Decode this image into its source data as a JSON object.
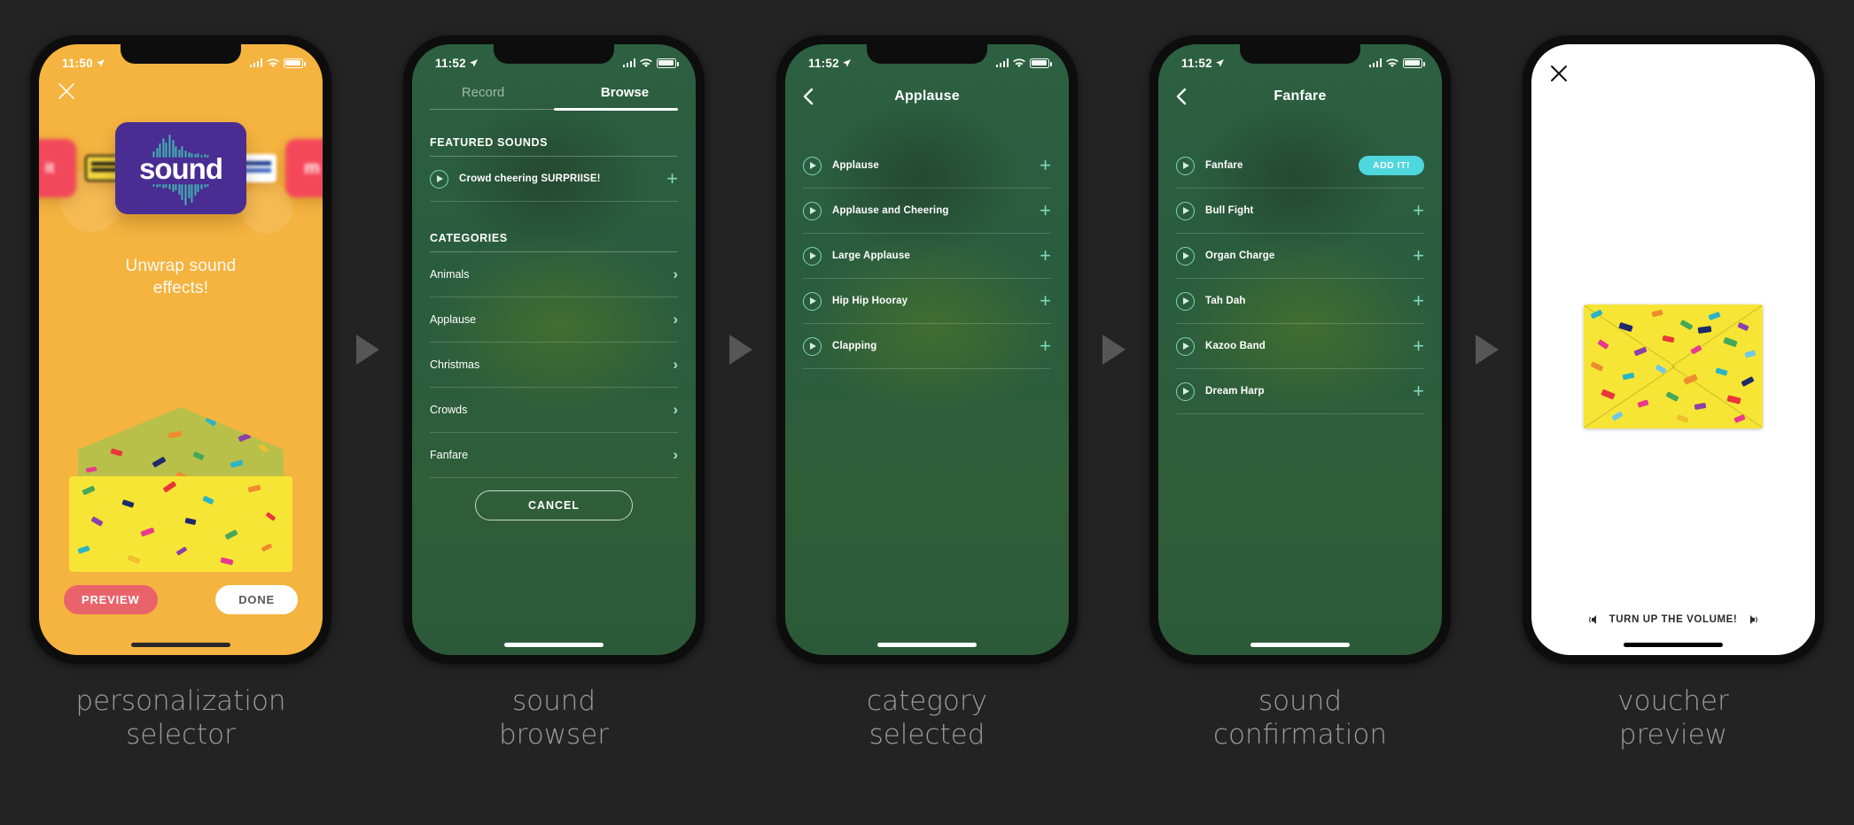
{
  "colors": {
    "board_bg": "#232323",
    "caption": "#9B9B9B",
    "arrow": "#565656",
    "amber": "#F5B33F",
    "green": "#2C6041",
    "teal_accent": "#7DD9C0",
    "cyan_button": "#4ED7DD",
    "preview_red": "#E9636B",
    "purple_tile": "#4A2D93",
    "voucher_yellow": "#F7E536"
  },
  "steps": [
    {
      "caption_line1": "personalization",
      "caption_line2": "selector",
      "screen": {
        "status": {
          "time": "11:50",
          "location_icon": "location-arrow-icon",
          "signal_icon": "cellular-bars-icon",
          "wifi_icon": "wifi-icon",
          "battery_icon": "battery-icon"
        },
        "close_icon": "close-icon",
        "tile_label": "sound",
        "title": "Unwrap sound effects!",
        "title_line1": "Unwrap sound",
        "title_line2": "effects!",
        "preview_label": "PREVIEW",
        "done_label": "DONE",
        "envelope_icon": "confetti-envelope-graphic"
      }
    },
    {
      "caption_line1": "sound",
      "caption_line2": "browser",
      "screen": {
        "status": {
          "time": "11:52",
          "location_icon": "location-arrow-icon",
          "signal_icon": "cellular-bars-icon",
          "wifi_icon": "wifi-icon",
          "battery_icon": "battery-icon"
        },
        "tabs": [
          {
            "label": "Record",
            "active": false
          },
          {
            "label": "Browse",
            "active": true
          }
        ],
        "featured_label": "FEATURED SOUNDS",
        "featured_items": [
          {
            "name": "Crowd cheering SURPRIISE!",
            "play_icon": "play-circle-icon",
            "add_icon": "plus-icon"
          }
        ],
        "categories_label": "CATEGORIES",
        "categories": [
          {
            "name": "Animals",
            "chevron_icon": "chevron-right-icon"
          },
          {
            "name": "Applause",
            "chevron_icon": "chevron-right-icon"
          },
          {
            "name": "Christmas",
            "chevron_icon": "chevron-right-icon"
          },
          {
            "name": "Crowds",
            "chevron_icon": "chevron-right-icon"
          },
          {
            "name": "Fanfare",
            "chevron_icon": "chevron-right-icon"
          }
        ],
        "cancel_label": "CANCEL"
      }
    },
    {
      "caption_line1": "category",
      "caption_line2": "selected",
      "screen": {
        "status": {
          "time": "11:52",
          "location_icon": "location-arrow-icon",
          "signal_icon": "cellular-bars-icon",
          "wifi_icon": "wifi-icon",
          "battery_icon": "battery-icon"
        },
        "back_icon": "chevron-left-icon",
        "title": "Applause",
        "sounds": [
          {
            "name": "Applause",
            "play_icon": "play-circle-icon",
            "action": "plus",
            "add_icon": "plus-icon"
          },
          {
            "name": "Applause and Cheering",
            "play_icon": "play-circle-icon",
            "action": "plus",
            "add_icon": "plus-icon"
          },
          {
            "name": "Large Applause",
            "play_icon": "play-circle-icon",
            "action": "plus",
            "add_icon": "plus-icon"
          },
          {
            "name": "Hip Hip Hooray",
            "play_icon": "play-circle-icon",
            "action": "plus",
            "add_icon": "plus-icon"
          },
          {
            "name": "Clapping",
            "play_icon": "play-circle-icon",
            "action": "plus",
            "add_icon": "plus-icon"
          }
        ]
      }
    },
    {
      "caption_line1": "sound",
      "caption_line2": "confirmation",
      "screen": {
        "status": {
          "time": "11:52",
          "location_icon": "location-arrow-icon",
          "signal_icon": "cellular-bars-icon",
          "wifi_icon": "wifi-icon",
          "battery_icon": "battery-icon"
        },
        "back_icon": "chevron-left-icon",
        "title": "Fanfare",
        "add_it_label": "ADD IT!",
        "sounds": [
          {
            "name": "Fanfare",
            "play_icon": "play-circle-icon",
            "action": "add-it",
            "add_label": "ADD IT!"
          },
          {
            "name": "Bull Fight",
            "play_icon": "play-circle-icon",
            "action": "plus",
            "add_icon": "plus-icon"
          },
          {
            "name": "Organ Charge",
            "play_icon": "play-circle-icon",
            "action": "plus",
            "add_icon": "plus-icon"
          },
          {
            "name": "Tah Dah",
            "play_icon": "play-circle-icon",
            "action": "plus",
            "add_icon": "plus-icon"
          },
          {
            "name": "Kazoo Band",
            "play_icon": "play-circle-icon",
            "action": "plus",
            "add_icon": "plus-icon"
          },
          {
            "name": "Dream Harp",
            "play_icon": "play-circle-icon",
            "action": "plus",
            "add_icon": "plus-icon"
          }
        ]
      }
    },
    {
      "caption_line1": "voucher",
      "caption_line2": "preview",
      "screen": {
        "close_icon": "close-icon",
        "voucher_icon": "confetti-envelope-graphic",
        "volume_text": "TURN UP THE VOLUME!",
        "speaker_left_icon": "speaker-waves-icon",
        "speaker_right_icon": "speaker-waves-icon"
      }
    }
  ],
  "arrows": [
    {
      "icon": "triangle-right-icon"
    },
    {
      "icon": "triangle-right-icon"
    },
    {
      "icon": "triangle-right-icon"
    },
    {
      "icon": "triangle-right-icon"
    }
  ]
}
